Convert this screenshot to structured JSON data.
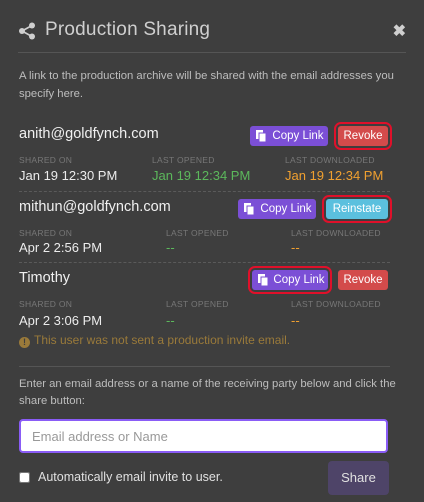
{
  "header": {
    "title": "Production Sharing",
    "close_label": "✖"
  },
  "intro": "A link to the production archive will be shared with the email addresses you specify here.",
  "labels": {
    "shared_on": "SHARED ON",
    "last_opened": "LAST OPENED",
    "last_downloaded": "LAST DOWNLOADED"
  },
  "recipients": [
    {
      "name": "anith@goldfynch.com",
      "copy_label": "Copy Link",
      "action_label": "Revoke",
      "shared_on": "Jan 19 12:30 PM",
      "last_opened": "Jan 19 12:34 PM",
      "last_downloaded": "Jan 19 12:34 PM"
    },
    {
      "name": "mithun@goldfynch.com",
      "copy_label": "Copy Link",
      "action_label": "Reinstate",
      "shared_on": "Apr 2 2:56 PM",
      "last_opened": "--",
      "last_downloaded": "--"
    },
    {
      "name": "Timothy",
      "copy_label": "Copy Link",
      "action_label": "Revoke",
      "shared_on": "Apr 2 3:06 PM",
      "last_opened": "--",
      "last_downloaded": "--",
      "warning": "This user was not sent a production invite email."
    }
  ],
  "instructions": "Enter an email address or a name of the receiving party below and click the share button:",
  "input": {
    "placeholder": "Email address or Name",
    "value": ""
  },
  "auto_email_label": "Automatically email invite to user.",
  "share_label": "Share",
  "icons": {
    "header": "share-icon",
    "copy": "document-icon",
    "close": "close-icon",
    "warning": "exclamation-circle-icon"
  },
  "colors": {
    "copy": "#7b4fd6",
    "revoke": "#d34b4b",
    "reinstate": "#5bc0de",
    "opened": "#5cb85c",
    "downloaded": "#f0a030",
    "highlight": "#e0102a"
  }
}
